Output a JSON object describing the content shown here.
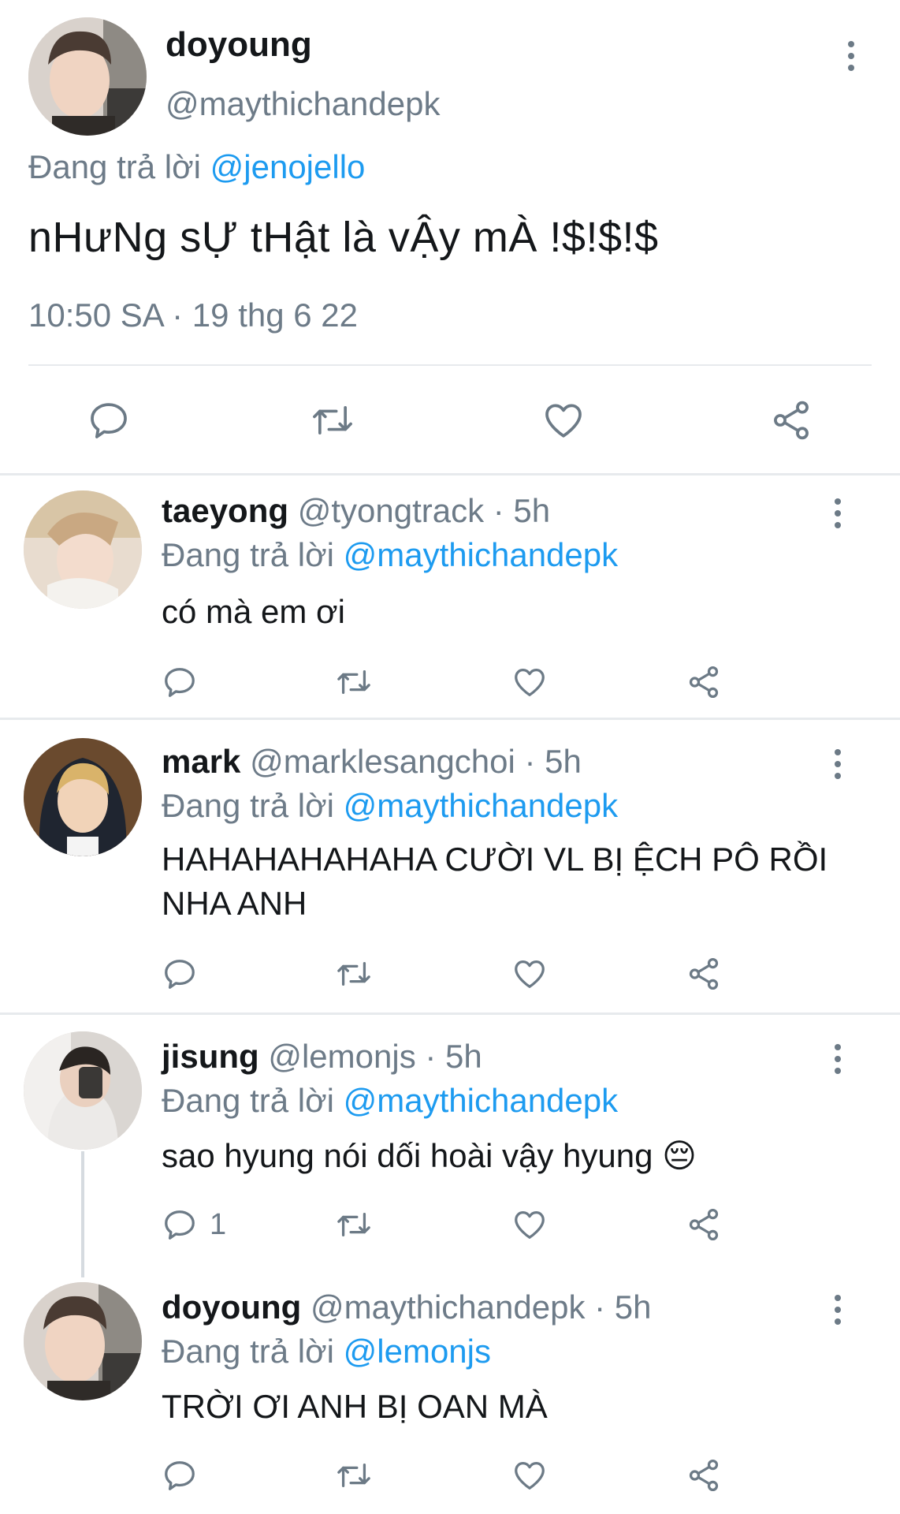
{
  "main_tweet": {
    "name": "doyoung",
    "handle": "@maythichandepk",
    "replying_prefix": "Đang trả lời",
    "replying_to": "@jenojello",
    "text": "nHưNg sỰ tHật là vẬy mÀ !$!$!$",
    "timestamp": "10:50 SA · 19 thg 6 22",
    "actions": [
      "reply-icon",
      "retweet-icon",
      "like-icon",
      "share-icon"
    ]
  },
  "replies": [
    {
      "name": "taeyong",
      "handle": "@tyongtrack",
      "time": "· 5h",
      "replying_prefix": "Đang trả lời",
      "replying_to": "@maythichandepk",
      "text": "có mà em ơi",
      "reply_count": ""
    },
    {
      "name": "mark",
      "handle": "@marklesangchoi",
      "time": "· 5h",
      "replying_prefix": "Đang trả lời",
      "replying_to": "@maythichandepk",
      "text": "HAHAHAHAHAHA CƯỜI VL BỊ ỆCH PÔ RỒI NHA ANH",
      "reply_count": ""
    },
    {
      "name": "jisung",
      "handle": "@lemonjs",
      "time": "· 5h",
      "replying_prefix": "Đang trả lời",
      "replying_to": "@maythichandepk",
      "text": "sao hyung nói dối hoài vậy hyung 😔",
      "reply_count": "1"
    },
    {
      "name": "doyoung",
      "handle": "@maythichandepk",
      "time": "· 5h",
      "replying_prefix": "Đang trả lời",
      "replying_to": "@lemonjs",
      "text": "TRỜI ƠI ANH BỊ OAN MÀ",
      "reply_count": ""
    }
  ],
  "colors": {
    "link": "#1d9bf0",
    "muted": "#6d7b88",
    "icon": "#6c7a86",
    "divider": "#e7eaed"
  }
}
